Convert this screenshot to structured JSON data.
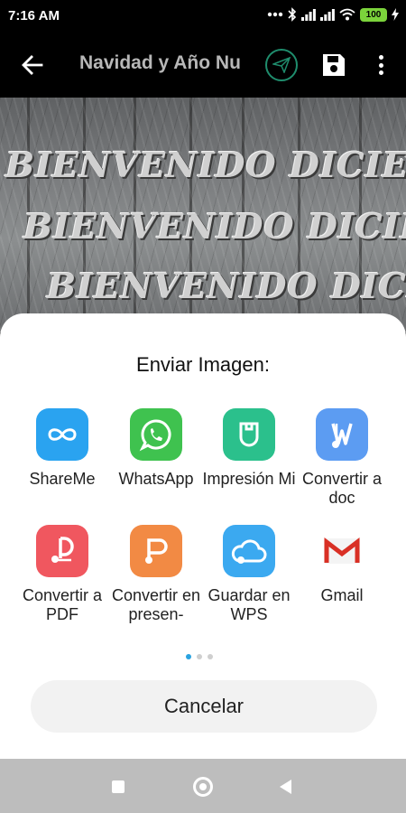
{
  "status_bar": {
    "time": "7:16 AM",
    "battery": "100"
  },
  "toolbar": {
    "title": "Navidad y Año Nuevo",
    "icons": [
      "back-arrow",
      "paper-plane",
      "floppy-disk",
      "more-vertical"
    ],
    "accent_color": "#1f8d6d"
  },
  "background": {
    "greeting_lines": [
      "BIENVENIDO DICIEMBRE",
      "BIENVENIDO DICIEMBRE",
      "BIENVENIDO DICIEMBRE"
    ]
  },
  "share_sheet": {
    "title": "Enviar Imagen:",
    "apps": [
      {
        "label": "ShareMe",
        "icon": "shareme-infinity-icon",
        "color": "#2aa3f0"
      },
      {
        "label": "WhatsApp",
        "icon": "whatsapp-icon",
        "color": "#3fc24f"
      },
      {
        "label": "Impresión Mi",
        "icon": "mi-print-icon",
        "color": "#2bc08c"
      },
      {
        "label": "Convertir a doc",
        "icon": "wps-doc-icon",
        "color": "#5c9cf2"
      },
      {
        "label": "Convertir a PDF",
        "icon": "wps-pdf-icon",
        "color": "#f0575f"
      },
      {
        "label": "Convertir en presen-",
        "icon": "wps-presentation-icon",
        "color": "#f28a44"
      },
      {
        "label": "Guardar en WPS",
        "icon": "wps-cloud-icon",
        "color": "#3ba9f0"
      },
      {
        "label": "Gmail",
        "icon": "gmail-icon",
        "color": "#d93025"
      }
    ],
    "page_count": 3,
    "active_page": 0,
    "cancel_label": "Cancelar"
  }
}
